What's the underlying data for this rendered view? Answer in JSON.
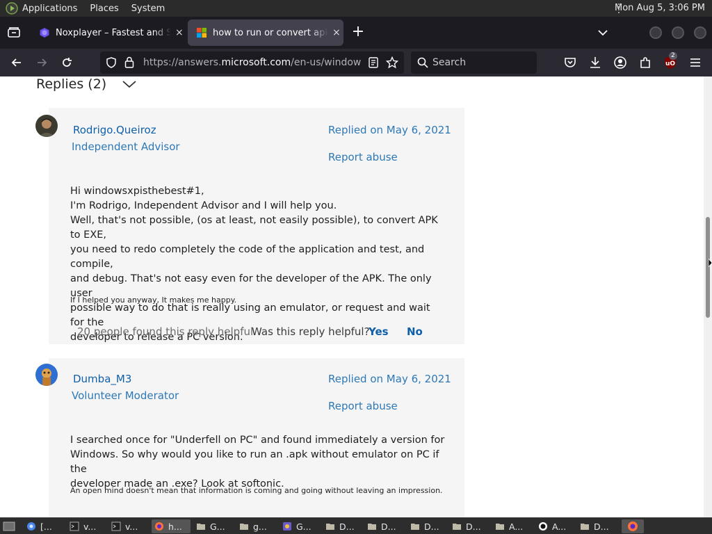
{
  "top_panel": {
    "menus": [
      "Applications",
      "Places",
      "System"
    ],
    "clock": "Mon Aug  5,  3:06 PM"
  },
  "tabs": [
    {
      "title": "Noxplayer – Fastest and Smoothest",
      "close": "×"
    },
    {
      "title": "how to run or convert apk file",
      "close": "×"
    }
  ],
  "tab_bar": {
    "new_tab": "+"
  },
  "nav": {
    "url_prefix": "https://answers.",
    "url_domain": "microsoft.com",
    "url_suffix": "/en-us/windows/forum",
    "search_placeholder": "Search",
    "ublock_count": "2"
  },
  "page": {
    "replies_heading": "Replies (2)",
    "replies": [
      {
        "user": "Rodrigo.Queiroz",
        "role": "Independent Advisor",
        "replied": "Replied on May 6, 2021",
        "report": "Report abuse",
        "body": [
          "Hi windowsxpisthebest#1,",
          "I'm Rodrigo, Independent Advisor and I will help you.",
          "Well, that's not possible, (os at least, not easily possible), to convert APK to EXE,",
          "you need to redo completely the code of the application and test, and compile,",
          "and debug. That's not easy even for the developer of the APK. The only user",
          "possible way to do that is really using an emulator, or request and wait for the",
          "developer to release a PC version."
        ],
        "signature": "If I helped you anyway, It makes me happy.",
        "helpful_count": "20 people found this reply helpful",
        "separator": "·",
        "question": "Was this reply helpful?",
        "yes": "Yes",
        "no": "No"
      },
      {
        "user": "Dumba_M3",
        "role": "Volunteer Moderator",
        "replied": "Replied on May 6, 2021",
        "report": "Report abuse",
        "body": [
          "I searched once for \"Underfell on PC\" and found immediately a version for",
          "Windows. So why would you like to run an .apk without emulator on PC if the",
          "developer made an .exe? Look at softonic."
        ],
        "signature": "An open mind doesn't mean that information is coming and going without leaving an impression."
      }
    ]
  },
  "taskbar": {
    "items": [
      "[...",
      "v...",
      "v...",
      "h...",
      "G...",
      "g...",
      "G...",
      "D...",
      "D...",
      "D...",
      "D...",
      "A...",
      "A...",
      "D..."
    ]
  },
  "colors": {
    "link": "#0f5fa8",
    "card_bg": "#f5f5f6",
    "toolbar_dark": "#1c1b22",
    "nav_bg": "#2b2a33"
  }
}
